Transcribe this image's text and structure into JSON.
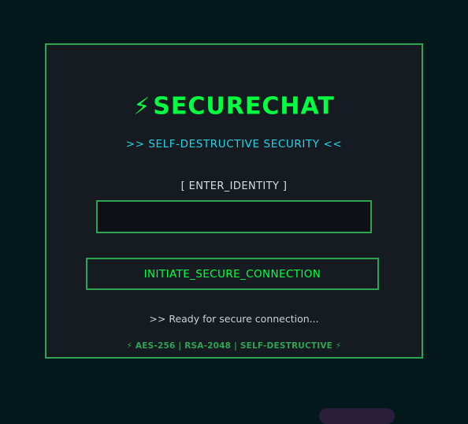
{
  "header": {
    "icon": "lightning-bolt-icon",
    "icon_glyph": "⚡",
    "title": "SECURECHAT",
    "subtitle": ">> SELF-DESTRUCTIVE SECURITY <<"
  },
  "identity": {
    "label": "[ ENTER_IDENTITY ]",
    "value": "",
    "placeholder": ""
  },
  "connect_button": {
    "label": "INITIATE_SECURE_CONNECTION"
  },
  "status": {
    "text": ">> Ready for secure connection..."
  },
  "footer": {
    "text": "⚡ AES-256 | RSA-2048 | SELF-DESTRUCTIVE ⚡"
  },
  "colors": {
    "background": "#03181a",
    "panel": "#161b22",
    "accent_green": "#00ff41",
    "border_green": "#2ea352",
    "cyan": "#22d3e6"
  }
}
